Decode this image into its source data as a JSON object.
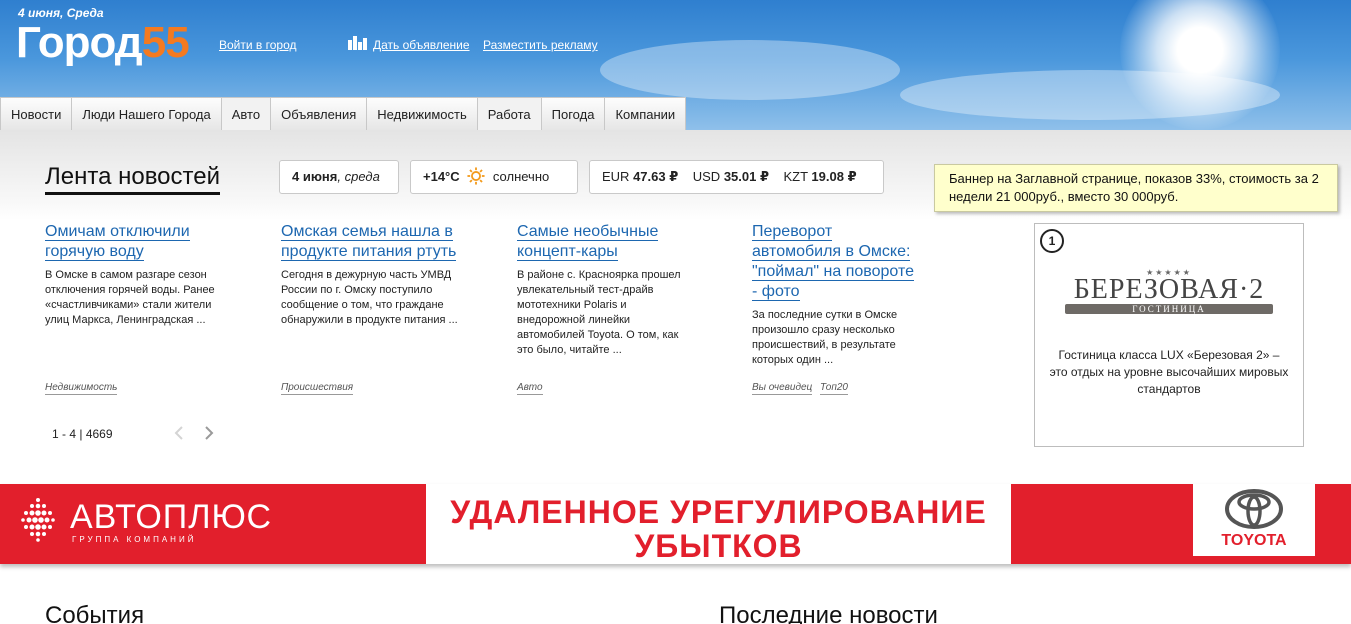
{
  "header": {
    "date": "4 июня, Среда",
    "logo_word": "Город",
    "logo_number": "55",
    "login_link": "Войти в город",
    "post_ad_link": "Дать объявление",
    "place_ad_link": "Разместить рекламу"
  },
  "nav": {
    "tabs": [
      {
        "label": "Новости"
      },
      {
        "label": "Люди Нашего Города"
      },
      {
        "label": "Авто"
      },
      {
        "label": "Объявления"
      },
      {
        "label": "Недвижимость"
      },
      {
        "label": "Работа"
      },
      {
        "label": "Погода"
      },
      {
        "label": "Компании"
      }
    ]
  },
  "feed": {
    "title": "Лента новостей",
    "date_day": "4 июня",
    "date_weekday": ", среда",
    "temperature": "+14°C",
    "weather": "солнечно",
    "currency": [
      {
        "code": "EUR",
        "value": "47.63 ₽"
      },
      {
        "code": "USD",
        "value": "35.01 ₽"
      },
      {
        "code": "KZT",
        "value": "19.08 ₽"
      }
    ]
  },
  "banner_note": "Баннер на Заглавной странице, показов 33%, стоимость за 2 недели 21 000руб., вместо 30 000руб.",
  "news": [
    {
      "title": "Омичам отключили горячую воду",
      "text": "В Омске в самом разгаре сезон отключения горячей воды. Ранее «счастливчиками» стали жители улиц Маркса, Ленинградская ...",
      "tags": [
        "Недвижимость"
      ]
    },
    {
      "title": "Омская семья нашла в продукте питания ртуть",
      "text": "Сегодня в дежурную часть УМВД России по г. Омску поступило сообщение о том, что граждане обнаружили в продукте питания ...",
      "tags": [
        "Происшествия"
      ]
    },
    {
      "title": "Самые необычные концепт-кары",
      "text": "В районе с. Красноярка прошел увлекательный тест-драйв мототехники Polaris и внедорожной линейки автомобилей Toyota. О том, как это было, читайте ...",
      "tags": [
        "Авто"
      ]
    },
    {
      "title": "Переворот автомобиля в Омске: \"поймал\" на повороте - фото",
      "text": "За последние сутки в Омске произошло сразу несколько происшествий, в результате которых один ...",
      "tags": [
        "Вы очевидец",
        "Топ20"
      ]
    }
  ],
  "pager": {
    "range": "1 - 4",
    "separator": "|",
    "total": "4669"
  },
  "hotel_ad": {
    "number": "1",
    "stars": "★★★★★",
    "name": "БЕРЕЗОВАЯ·2",
    "subtitle": "ГОСТИНИЦА",
    "description": "Гостиница класса LUX «Березовая 2» – это отдых на уровне высочайших мировых стандартов"
  },
  "red_banner": {
    "brand": "АВТОПЛЮС",
    "brand_sub": "ГРУППА КОМПАНИЙ",
    "slogan_line1": "УДАЛЕННОЕ УРЕГУЛИРОВАНИЕ",
    "slogan_line2": "УБЫТКОВ",
    "partner": "TOYOTA"
  },
  "sections": {
    "events": "События",
    "latest_news": "Последние новости"
  },
  "colors": {
    "accent_orange": "#f47a20",
    "link_blue": "#1d67b0",
    "banner_red": "#e21f2c"
  }
}
